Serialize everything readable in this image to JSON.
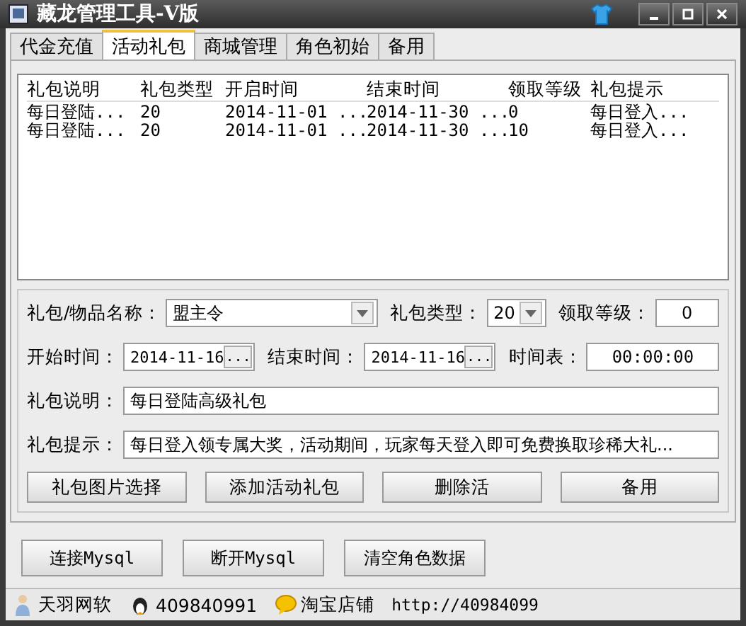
{
  "window": {
    "title": "藏龙管理工具-V版"
  },
  "tabs": [
    {
      "label": "代金充值",
      "selected": false
    },
    {
      "label": "活动礼包",
      "selected": true
    },
    {
      "label": "商城管理",
      "selected": false
    },
    {
      "label": "角色初始",
      "selected": false
    },
    {
      "label": "备用",
      "selected": false
    }
  ],
  "table": {
    "columns": [
      "礼包说明",
      "礼包类型",
      "开启时间",
      "结束时间",
      "领取等级",
      "礼包提示"
    ],
    "rows": [
      [
        "每日登陆...",
        "20",
        "2014-11-01 ...",
        "2014-11-30 ...",
        "0",
        "每日登入..."
      ],
      [
        "每日登陆...",
        "20",
        "2014-11-01 ...",
        "2014-11-30 ...",
        "10",
        "每日登入..."
      ]
    ]
  },
  "form": {
    "item_name": {
      "label": "礼包/物品名称：",
      "value": "盟主令"
    },
    "gift_type": {
      "label": "礼包类型：",
      "value": "20"
    },
    "level": {
      "label": "领取等级：",
      "value": "0"
    },
    "start": {
      "label": "开始时间：",
      "value": "2014-11-16",
      "button": "..."
    },
    "end": {
      "label": "结束时间：",
      "value": "2014-11-16",
      "button": "..."
    },
    "schedule": {
      "label": "时间表：",
      "value": "00:00:00"
    },
    "description": {
      "label": "礼包说明：",
      "value": "每日登陆高级礼包"
    },
    "hint": {
      "label": "礼包提示：",
      "value": "每日登入领专属大奖，活动期间，玩家每天登入即可免费换取珍稀大礼..."
    }
  },
  "form_buttons": [
    "礼包图片选择",
    "添加活动礼包",
    "删除活",
    "备用"
  ],
  "bottom_buttons": [
    "连接Mysql",
    "断开Mysql",
    "清空角色数据"
  ],
  "status_bar": [
    {
      "kind": "person",
      "text": "天羽网软"
    },
    {
      "kind": "penguin",
      "text": "409840991"
    },
    {
      "kind": "chat",
      "text": "淘宝店铺"
    },
    {
      "kind": "link",
      "text": "http://40984099"
    }
  ]
}
